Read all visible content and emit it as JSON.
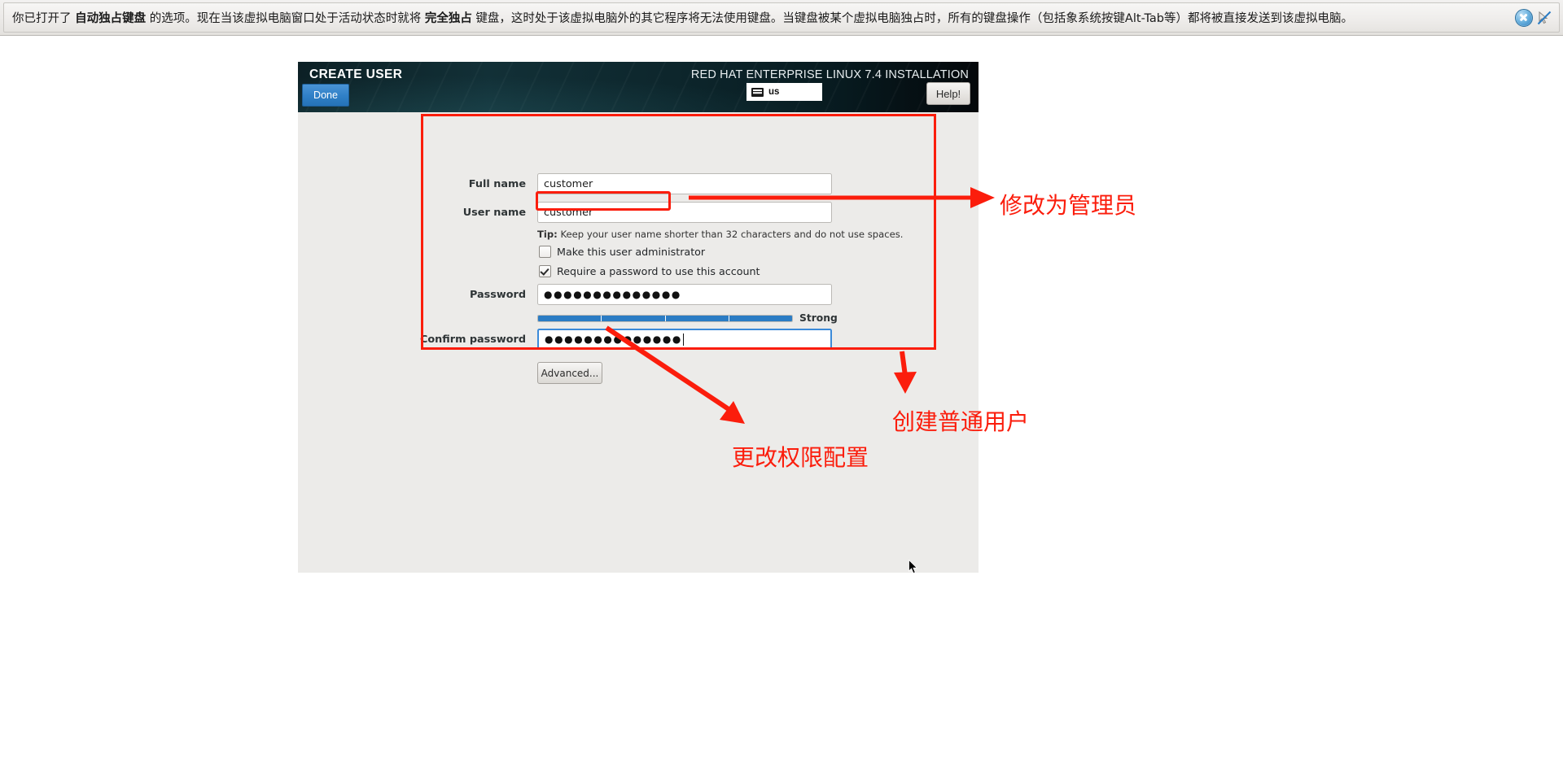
{
  "vbox_bar": {
    "message_parts": [
      {
        "text": "你已打开了 ",
        "bold": false
      },
      {
        "text": "自动独占键盘",
        "bold": true
      },
      {
        "text": " 的选项。现在当该虚拟电脑窗口处于活动状态时就将 ",
        "bold": false
      },
      {
        "text": "完全独占",
        "bold": true
      },
      {
        "text": " 键盘，这时处于该虚拟电脑外的其它程序将无法使用键盘。当键盘被某个虚拟电脑独占时，所有的键盘操作（包括象系统按键Alt-Tab等）都将被直接发送到该虚拟电脑。",
        "bold": false
      }
    ],
    "full_message": "你已打开了 自动独占键盘 的选项。现在当该虚拟电脑窗口处于活动状态时就将 完全独占 键盘，这时处于该虚拟电脑外的其它程序将无法使用键盘。当键盘被某个虚拟电脑独占时，所有的键盘操作（包括象系统按键Alt-Tab等）都将被直接发送到该虚拟电脑。",
    "close_icon": "close-circle-icon",
    "hide_icon": "no-entry-pointer-icon"
  },
  "installer": {
    "header": {
      "spoke_title": "CREATE USER",
      "product_title": "RED HAT ENTERPRISE LINUX 7.4 INSTALLATION",
      "done_label": "Done",
      "help_label": "Help!",
      "keyboard_layout": "us",
      "keyboard_icon": "keyboard-icon"
    },
    "form": {
      "full_name_label": "Full name",
      "full_name_value": "customer",
      "user_name_label": "User name",
      "user_name_value": "customer",
      "tip_prefix": "Tip:",
      "tip_text": " Keep your user name shorter than 32 characters and do not use spaces.",
      "admin_checkbox_label": "Make this user administrator",
      "admin_checkbox_checked": false,
      "require_password_label": "Require a password to use this account",
      "require_password_checked": true,
      "password_label": "Password",
      "password_value": "●●●●●●●●●●●●●●",
      "confirm_password_label": "Confirm password",
      "confirm_password_value": "●●●●●●●●●●●●●●",
      "strength_label": "Strong",
      "strength_segments_filled": 4,
      "strength_segments_total": 4,
      "advanced_label": "Advanced..."
    }
  },
  "annotations": {
    "accent_color": "#fb1d0c",
    "make_admin": "修改为管理员",
    "create_normal_user": "创建普通用户",
    "change_permission_config": "更改权限配置"
  }
}
